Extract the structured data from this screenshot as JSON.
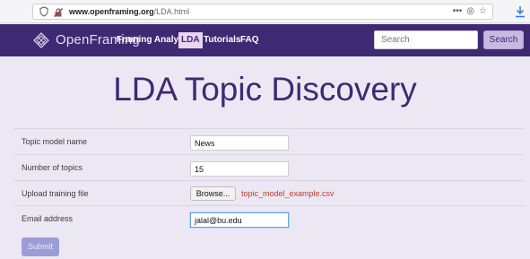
{
  "browser": {
    "url_domain": "www.openframing.org",
    "url_path": "/LDA.html",
    "actions_icons": [
      "more-dots-icon",
      "pocket-icon",
      "star-icon"
    ],
    "more_label": "•••",
    "pocket_label": "◎",
    "star_label": "☆"
  },
  "navbar": {
    "brand": "OpenFraming",
    "links": [
      {
        "label": "Framing Analysis"
      },
      {
        "label": "LDA",
        "active": true
      },
      {
        "label": "Tutorials"
      },
      {
        "label": "FAQ"
      }
    ],
    "search_placeholder": "Search",
    "search_button": "Search"
  },
  "hero": {
    "title": "LDA Topic Discovery"
  },
  "form": {
    "rows": [
      {
        "label": "Topic model name",
        "value": "News"
      },
      {
        "label": "Number of topics",
        "value": "15"
      },
      {
        "label": "Upload training file",
        "button": "Browse...",
        "file": "topic_model_example.csv"
      },
      {
        "label": "Email address",
        "value": "jalal@bu.edu"
      }
    ],
    "submit": "Submit"
  },
  "colors": {
    "navbar_bg": "#3e2a73",
    "page_bg": "#ece8f3",
    "title": "#3e2a73",
    "file_name": "#c0392b",
    "submit_bg": "#9c9dd6"
  }
}
